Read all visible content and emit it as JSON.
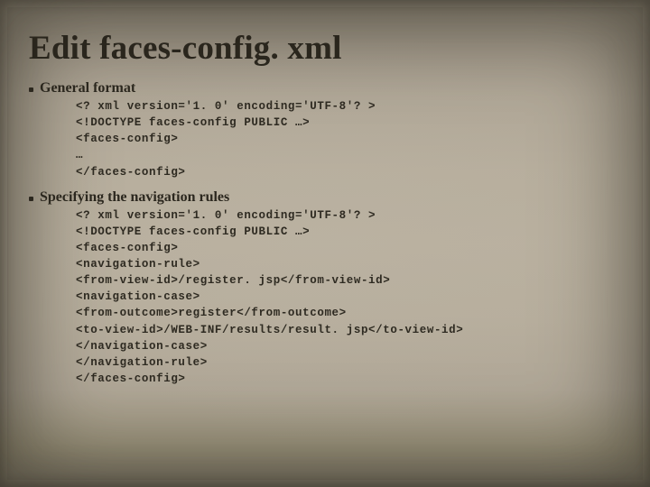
{
  "title": "Edit faces-config. xml",
  "sections": [
    {
      "heading": "General format",
      "code": [
        "<? xml version='1. 0' encoding='UTF-8'? >",
        "<!DOCTYPE faces-config PUBLIC …>",
        "<faces-config>",
        "…",
        "</faces-config>"
      ]
    },
    {
      "heading": "Specifying the navigation rules",
      "code": [
        "<? xml version='1. 0' encoding='UTF-8'? >",
        "<!DOCTYPE faces-config PUBLIC …>",
        "<faces-config>",
        "<navigation-rule>",
        "<from-view-id>/register. jsp</from-view-id>",
        "<navigation-case>",
        "<from-outcome>register</from-outcome>",
        "<to-view-id>/WEB-INF/results/result. jsp</to-view-id>",
        "</navigation-case>",
        "</navigation-rule>",
        "</faces-config>"
      ]
    }
  ]
}
